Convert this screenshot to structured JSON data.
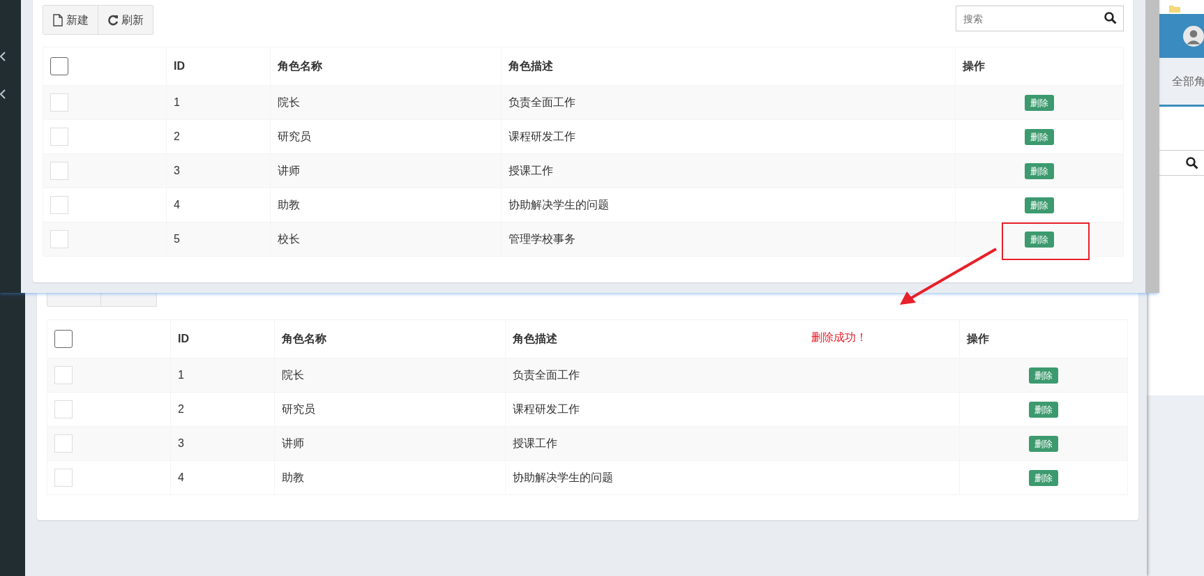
{
  "front_window": {
    "toolbar": {
      "buttons": [
        {
          "kind": "new",
          "label": "新建"
        },
        {
          "kind": "refresh",
          "label": "刷新"
        }
      ],
      "search": {
        "placeholder": "搜索"
      }
    },
    "table": {
      "header_checked": false,
      "columns": [
        "ID",
        "角色名称",
        "角色描述",
        "操作"
      ],
      "rows": [
        {
          "id": "1",
          "name": "院长",
          "description": "负责全面工作",
          "action": "删除",
          "checked": false,
          "marked": false
        },
        {
          "id": "2",
          "name": "研究员",
          "description": "课程研发工作",
          "action": "删除",
          "checked": false,
          "marked": false
        },
        {
          "id": "3",
          "name": "讲师",
          "description": "授课工作",
          "action": "删除",
          "checked": false,
          "marked": false
        },
        {
          "id": "4",
          "name": "助教",
          "description": "协助解决学生的问题",
          "action": "删除",
          "checked": false,
          "marked": false
        },
        {
          "id": "5",
          "name": "校长",
          "description": "管理学校事务",
          "action": "删除",
          "checked": false,
          "marked": true
        }
      ]
    }
  },
  "annotation": {
    "message": "删除成功！"
  },
  "back_window": {
    "table": {
      "header_checked": false,
      "columns": [
        "ID",
        "角色名称",
        "角色描述",
        "操作"
      ],
      "rows": [
        {
          "id": "1",
          "name": "院长",
          "description": "负责全面工作",
          "action": "删除",
          "checked": false
        },
        {
          "id": "2",
          "name": "研究员",
          "description": "课程研发工作",
          "action": "删除",
          "checked": false
        },
        {
          "id": "3",
          "name": "讲师",
          "description": "授课工作",
          "action": "删除",
          "checked": false
        },
        {
          "id": "4",
          "name": "助教",
          "description": "协助解决学生的问题",
          "action": "删除",
          "checked": false
        }
      ]
    }
  },
  "side_app": {
    "breadcrumb": "全部角"
  }
}
